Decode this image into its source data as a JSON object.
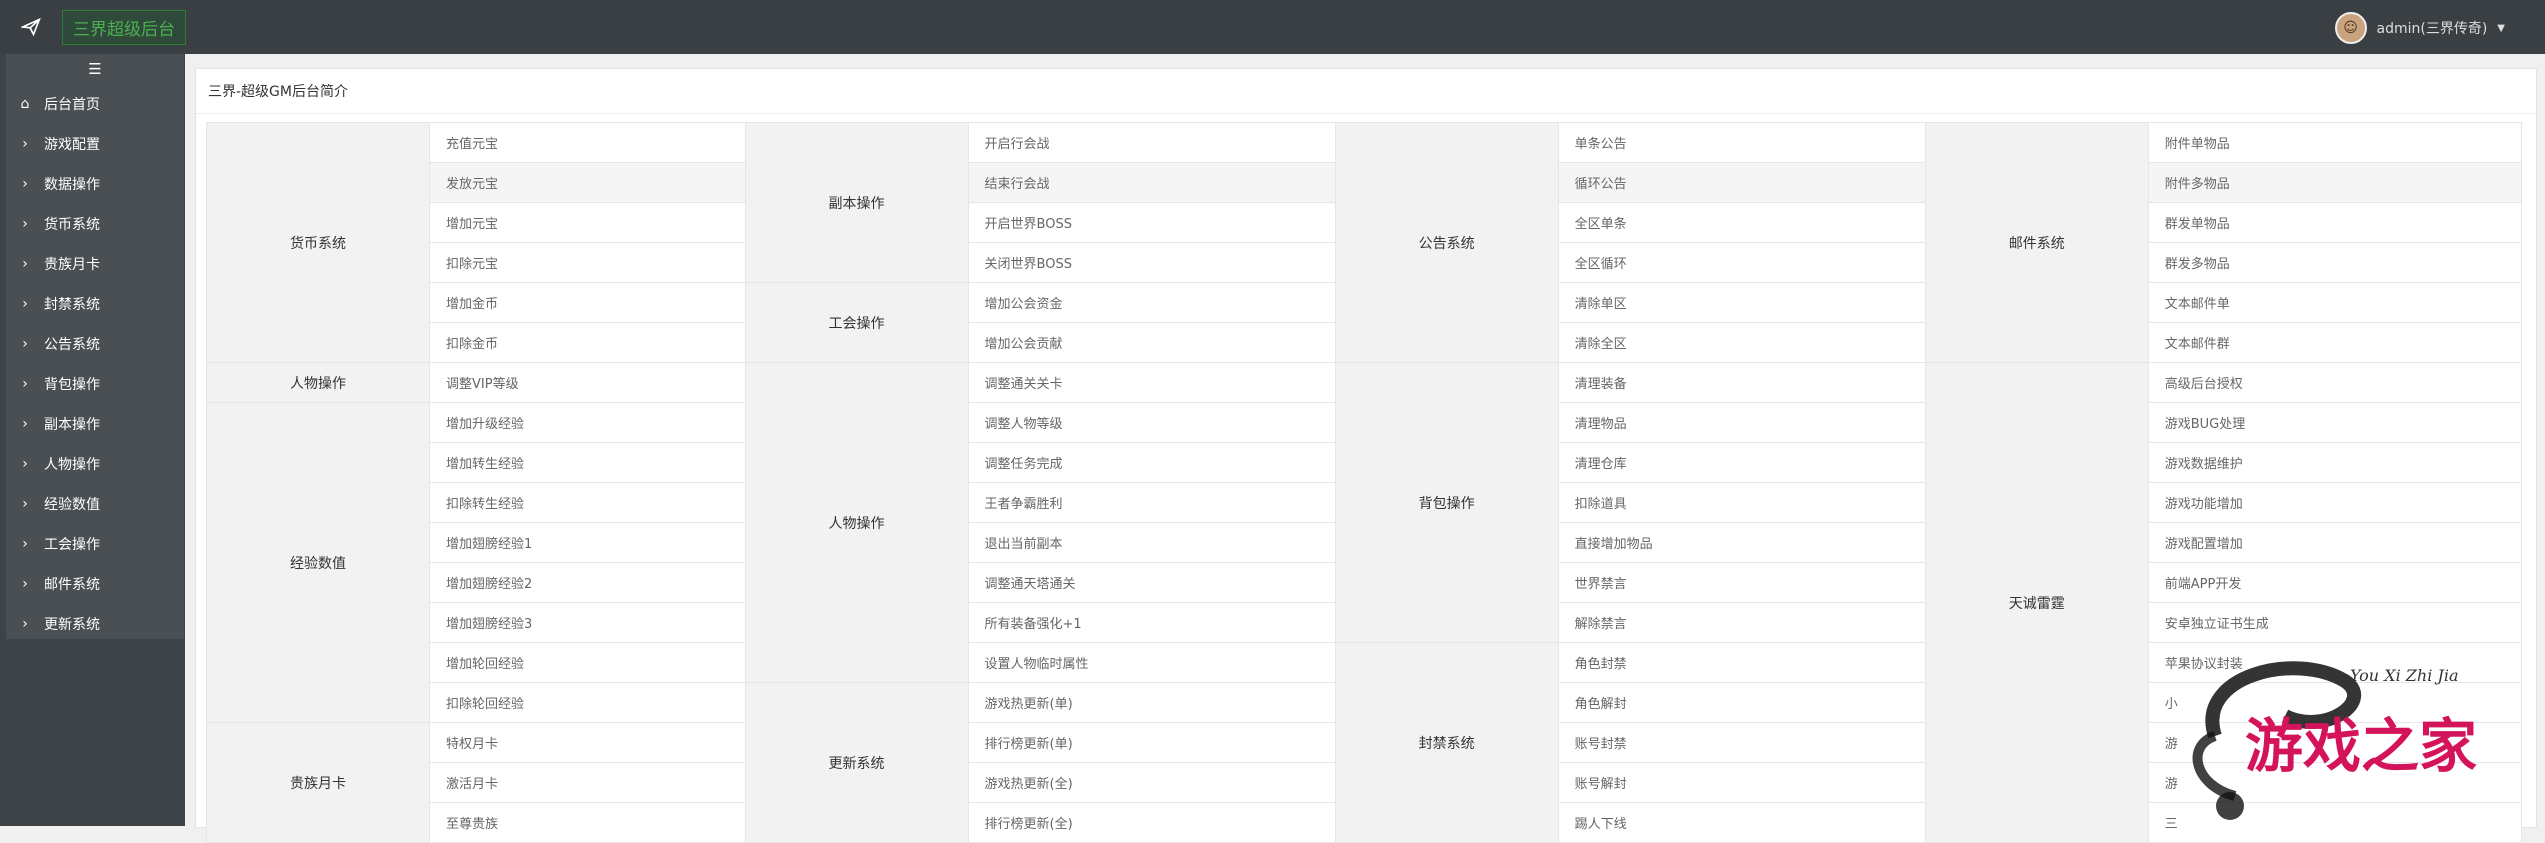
{
  "app_title": "三界超级后台",
  "user_label": "admin(三界传奇)",
  "sidebar": {
    "toggle_icon": "menu-icon",
    "items": [
      {
        "label": "后台首页",
        "icon": "home-icon"
      },
      {
        "label": "游戏配置",
        "icon": "chevron-right-icon"
      },
      {
        "label": "数据操作",
        "icon": "chevron-right-icon"
      },
      {
        "label": "货币系统",
        "icon": "chevron-right-icon"
      },
      {
        "label": "贵族月卡",
        "icon": "chevron-right-icon"
      },
      {
        "label": "封禁系统",
        "icon": "chevron-right-icon"
      },
      {
        "label": "公告系统",
        "icon": "chevron-right-icon"
      },
      {
        "label": "背包操作",
        "icon": "chevron-right-icon"
      },
      {
        "label": "副本操作",
        "icon": "chevron-right-icon"
      },
      {
        "label": "人物操作",
        "icon": "chevron-right-icon"
      },
      {
        "label": "经验数值",
        "icon": "chevron-right-icon"
      },
      {
        "label": "工会操作",
        "icon": "chevron-right-icon"
      },
      {
        "label": "邮件系统",
        "icon": "chevron-right-icon"
      },
      {
        "label": "更新系统",
        "icon": "chevron-right-icon"
      }
    ]
  },
  "panel_title": "三界-超级GM后台简介",
  "table": {
    "groups": {
      "c1": [
        {
          "label": "货币系统",
          "rows": 6
        },
        {
          "label": "人物操作",
          "rows": 1
        },
        {
          "label": "经验数值",
          "rows": 8
        },
        {
          "label": "贵族月卡",
          "rows": 3
        }
      ],
      "c2": [
        {
          "label": "副本操作",
          "rows": 4
        },
        {
          "label": "工会操作",
          "rows": 2
        },
        {
          "label": "人物操作",
          "rows": 8
        },
        {
          "label": "更新系统",
          "rows": 4
        }
      ],
      "c3": [
        {
          "label": "公告系统",
          "rows": 6
        },
        {
          "label": "背包操作",
          "rows": 7
        },
        {
          "label": "封禁系统",
          "rows": 5
        }
      ],
      "c4": [
        {
          "label": "邮件系统",
          "rows": 6
        },
        {
          "label": "天诚雷霆",
          "rows": 12
        }
      ]
    },
    "col1_items": [
      "充值元宝",
      "发放元宝",
      "增加元宝",
      "扣除元宝",
      "增加金币",
      "扣除金币",
      "调整VIP等级",
      "增加升级经验",
      "增加转生经验",
      "扣除转生经验",
      "增加翅膀经验1",
      "增加翅膀经验2",
      "增加翅膀经验3",
      "增加轮回经验",
      "扣除轮回经验",
      "特权月卡",
      "激活月卡",
      "至尊贵族"
    ],
    "col2_items": [
      "开启行会战",
      "结束行会战",
      "开启世界BOSS",
      "关闭世界BOSS",
      "增加公会资金",
      "增加公会贡献",
      "调整通关关卡",
      "调整人物等级",
      "调整任务完成",
      "王者争霸胜利",
      "退出当前副本",
      "调整通天塔通关",
      "所有装备强化+1",
      "设置人物临时属性",
      "游戏热更新(单)",
      "排行榜更新(单)",
      "游戏热更新(全)",
      "排行榜更新(全)"
    ],
    "col3_items": [
      "单条公告",
      "循环公告",
      "全区单条",
      "全区循环",
      "清除单区",
      "清除全区",
      "清理装备",
      "清理物品",
      "清理仓库",
      "扣除道具",
      "直接增加物品",
      "世界禁言",
      "解除禁言",
      "角色封禁",
      "角色解封",
      "账号封禁",
      "账号解封",
      "踢人下线"
    ],
    "col4_items": [
      "附件单物品",
      "附件多物品",
      "群发单物品",
      "群发多物品",
      "文本邮件单",
      "文本邮件群",
      "高级后台授权",
      "游戏BUG处理",
      "游戏数据维护",
      "游戏功能增加",
      "游戏配置增加",
      "前端APP开发",
      "安卓独立证书生成",
      "苹果协议封装",
      "小",
      "游",
      "游",
      "三"
    ]
  },
  "watermark": {
    "script": "You Xi Zhi Jia",
    "text": "游戏之家"
  },
  "colors": {
    "topbar": "#3a3f44",
    "sidebar": "#3e4348",
    "accent": "#4caf50",
    "watermark_red": "#d4145a"
  }
}
